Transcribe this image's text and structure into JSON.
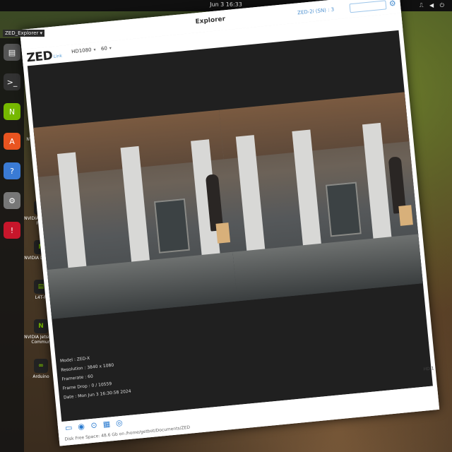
{
  "topbar": {
    "clock": "Jun 3 16:33",
    "tray": "⎍ ◀ ⏻"
  },
  "activity": {
    "title": "ZED_Explorer ▾"
  },
  "dock": {
    "items": [
      {
        "name": "files-icon",
        "glyph": "▤",
        "color": "#555"
      },
      {
        "name": "terminal-icon",
        "glyph": ">_",
        "color": "#333"
      },
      {
        "name": "nvidia-icon",
        "glyph": "N",
        "color": "#76b900"
      },
      {
        "name": "software-icon",
        "glyph": "A",
        "color": "#e95420"
      },
      {
        "name": "help-icon",
        "glyph": "?",
        "color": "#3a7bd5"
      },
      {
        "name": "settings-icon",
        "glyph": "⚙",
        "color": "#777"
      },
      {
        "name": "update-icon",
        "glyph": "!",
        "color": "#c7162b"
      }
    ]
  },
  "desktop_icons": [
    {
      "label": "getbo",
      "glyph": "⌂"
    },
    {
      "label": "Tr",
      "glyph": "🗑"
    },
    {
      "label": "NVIDIA Jetson",
      "glyph": "N"
    },
    {
      "label": "Term",
      "glyph": ">_"
    },
    {
      "label": "NVIDIA Jetson D Foru",
      "glyph": "N"
    },
    {
      "label": "NVIDIA Develop",
      "glyph": "N"
    },
    {
      "label": "L4T-R",
      "glyph": "▤"
    },
    {
      "label": "NVIDIA Jetson D Commun",
      "glyph": "N"
    },
    {
      "label": "Arduino",
      "glyph": "∞"
    }
  ],
  "window": {
    "title": "Explorer",
    "logo": "ZED",
    "logo_sub": "Link",
    "resolution": "HD1080",
    "fps": "60",
    "camera_info": "ZED-2i (SN) : 3",
    "search_placeholder": "",
    "info": {
      "model": "Model : ZED-X",
      "resolution": "Resolution : 3840 x 1080",
      "framerate": "Framerate : 60",
      "frame_drop": "Frame Drop : 0 / 10559",
      "date": "Date : Mon Jun 3 16:30:58 2024"
    },
    "side_info": "HD 1",
    "status_message": "Disk Free Space: 48.6 Gb  on  /home/getbot/Documents/ZED"
  }
}
